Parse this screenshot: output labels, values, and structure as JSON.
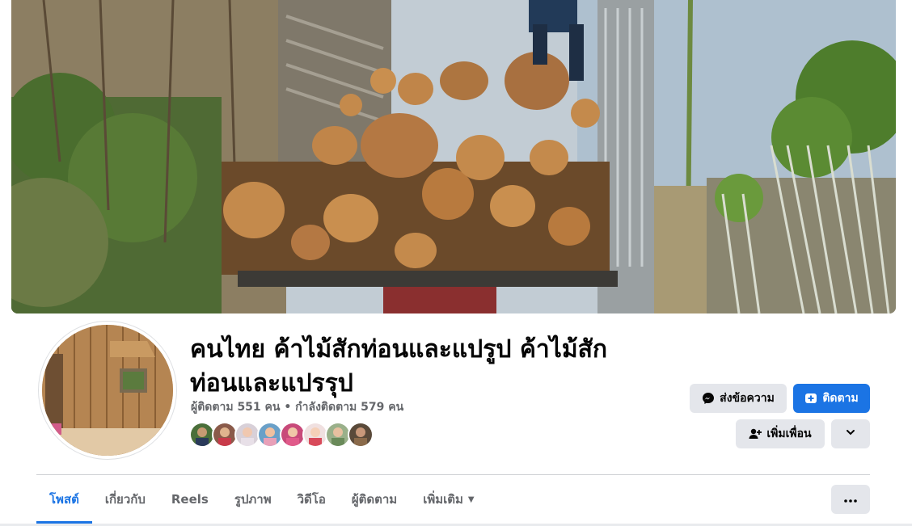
{
  "page": {
    "name": "คนไทย ค้าไม้สักท่อนและแปรูป ค้าไม้สักท่อนและแปรรุป",
    "followers": "ผู้ติดตาม 551 คน • กำลังติดตาม 579 คน"
  },
  "actions": {
    "message_label": "ส่งข้อความ",
    "follow_label": "ติดตาม",
    "add_friend_label": "เพิ่มเพื่อน"
  },
  "tabs": [
    {
      "label": "โพสต์"
    },
    {
      "label": "เกี่ยวกับ"
    },
    {
      "label": "Reels"
    },
    {
      "label": "รูปภาพ"
    },
    {
      "label": "วิดีโอ"
    },
    {
      "label": "ผู้ติดตาม"
    },
    {
      "label": "เพิ่มเติม"
    }
  ],
  "icons": {
    "message": "messenger-icon",
    "follow": "follow-icon",
    "add_friend": "add-friend-icon",
    "more": "chevron-down-icon",
    "tab_more": "caret-down-icon",
    "overflow": "more-dots-icon"
  },
  "colors": {
    "accent": "#1b74e4",
    "button_gray": "#e4e6eb",
    "text_secondary": "#65676b"
  }
}
